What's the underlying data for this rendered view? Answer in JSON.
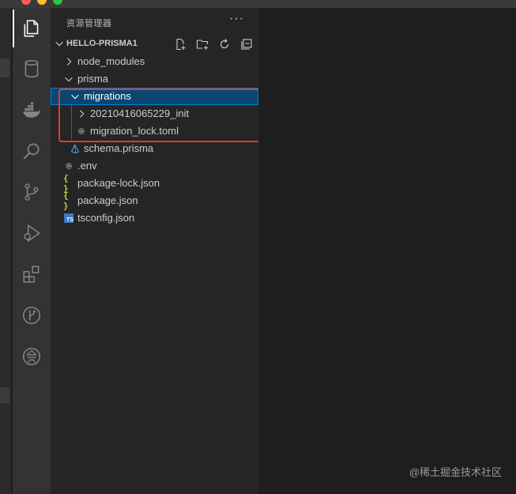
{
  "explorer": {
    "title": "资源管理器",
    "more": "···",
    "section": "HELLO-PRISMA1",
    "section_actions": [
      "new-file-icon",
      "new-folder-icon",
      "refresh-icon",
      "collapse-all-icon"
    ]
  },
  "tree": [
    {
      "name": "node_modules",
      "type": "folder",
      "expanded": false,
      "depth": 0
    },
    {
      "name": "prisma",
      "type": "folder",
      "expanded": true,
      "depth": 0
    },
    {
      "name": "migrations",
      "type": "folder",
      "expanded": true,
      "depth": 1,
      "selected": true
    },
    {
      "name": "20210416065229_init",
      "type": "folder",
      "expanded": false,
      "depth": 2
    },
    {
      "name": "migration_lock.toml",
      "type": "file",
      "icon": "gear-icon",
      "depth": 2
    },
    {
      "name": "schema.prisma",
      "type": "file",
      "icon": "prisma-icon",
      "depth": 1
    },
    {
      "name": ".env",
      "type": "file",
      "icon": "gear-icon",
      "depth": 0
    },
    {
      "name": "package-lock.json",
      "type": "file",
      "icon": "json-icon",
      "depth": 0
    },
    {
      "name": "package.json",
      "type": "file",
      "icon": "json-icon",
      "depth": 0
    },
    {
      "name": "tsconfig.json",
      "type": "file",
      "icon": "typescript-icon",
      "depth": 0
    }
  ],
  "icons": {
    "json": "{ }",
    "typescript": "TS"
  },
  "activity_bar": [
    "explorer-icon",
    "database-icon",
    "docker-icon",
    "search-icon",
    "source-control-icon",
    "run-debug-icon",
    "extensions-icon",
    "gitlens-icon",
    "remote-icon"
  ],
  "watermark": "@稀土掘金技术社区",
  "colors": {
    "selection": "#094771",
    "highlight_box": "#e03c31"
  }
}
